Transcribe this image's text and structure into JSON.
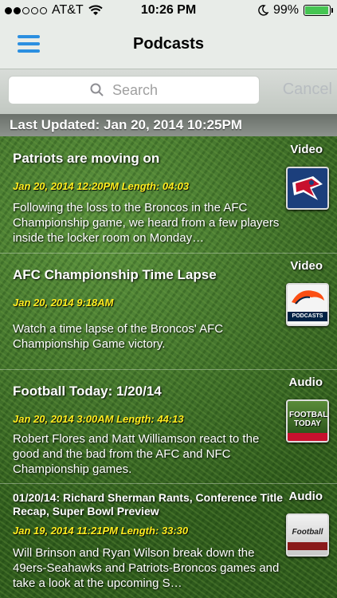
{
  "status": {
    "carrier": "AT&T",
    "time": "10:26 PM",
    "battery": "99%"
  },
  "nav": {
    "title": "Podcasts"
  },
  "search": {
    "placeholder": "Search",
    "cancel_label": "Cancel"
  },
  "last_updated": "Last Updated: Jan 20, 2014 10:25PM",
  "items": [
    {
      "title": "Patriots are moving on",
      "meta": "Jan 20, 2014 12:20PM  Length: 04:03",
      "description": "Following the loss to the Broncos in the AFC Championship game, we heard from a few players inside the locker room on Monday…",
      "type": "Video"
    },
    {
      "title": "AFC Championship Time Lapse",
      "meta": "Jan 20, 2014 9:18AM",
      "description": "Watch a time lapse of the Broncos' AFC Championship Game victory.",
      "type": "Video",
      "thumb_text": "PODCASTS"
    },
    {
      "title": "Football Today: 1/20/14",
      "meta": "Jan 20, 2014 3:00AM  Length: 44:13",
      "description": "Robert Flores and Matt Williamson react to the good and the bad from the AFC and NFC Championship games.",
      "type": "Audio",
      "thumb_text": "FOOTBALL TODAY"
    },
    {
      "title": "01/20/14: Richard Sherman Rants, Conference Title Recap, Super Bowl Preview",
      "meta": "Jan 19, 2014 11:21PM  Length: 33:30",
      "description": "Will Brinson and Ryan Wilson break down the 49ers-Seahawks and Patriots-Broncos games and take a look at the upcoming S…",
      "type": "Audio",
      "thumb_text": "Football"
    }
  ]
}
